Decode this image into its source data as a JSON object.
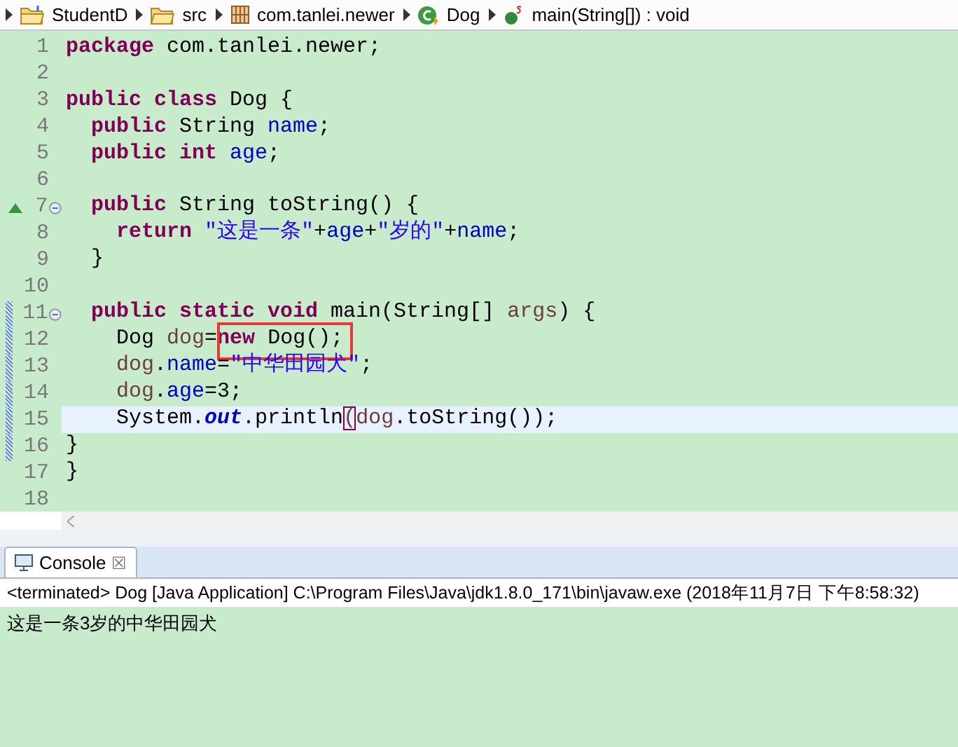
{
  "breadcrumb": [
    {
      "kind": "project",
      "label": "StudentD"
    },
    {
      "kind": "source-folder",
      "label": "src"
    },
    {
      "kind": "package",
      "label": "com.tanlei.newer"
    },
    {
      "kind": "class",
      "label": "Dog"
    },
    {
      "kind": "method",
      "label": "main(String[]) : void"
    }
  ],
  "editor": {
    "lines": [
      {
        "number": "1",
        "tokens": [
          {
            "t": "package ",
            "kind": "kw"
          },
          {
            "t": "com.tanlei.newer;",
            "kind": "plain"
          }
        ]
      },
      {
        "number": "2"
      },
      {
        "number": "3",
        "tokens": [
          {
            "t": "public class ",
            "kind": "kw"
          },
          {
            "t": "Dog {",
            "kind": "plain"
          }
        ]
      },
      {
        "number": "4",
        "tokens": [
          {
            "t": "  public ",
            "kind": "kw"
          },
          {
            "t": "String ",
            "kind": "plain"
          },
          {
            "t": "name",
            "kind": "field"
          },
          {
            "t": ";",
            "kind": "plain"
          }
        ]
      },
      {
        "number": "5",
        "tokens": [
          {
            "t": "  public int ",
            "kind": "kw"
          },
          {
            "t": "age",
            "kind": "field"
          },
          {
            "t": ";",
            "kind": "plain"
          }
        ]
      },
      {
        "number": "6"
      },
      {
        "number": "7",
        "override": true,
        "foldable": true,
        "tokens": [
          {
            "t": "  public ",
            "kind": "kw"
          },
          {
            "t": "String toString() {",
            "kind": "plain"
          }
        ]
      },
      {
        "number": "8",
        "tokens": [
          {
            "t": "    return ",
            "kind": "kw"
          },
          {
            "t": "\"这是一条\"",
            "kind": "string"
          },
          {
            "t": "+",
            "kind": "plain"
          },
          {
            "t": "age",
            "kind": "field"
          },
          {
            "t": "+",
            "kind": "plain"
          },
          {
            "t": "\"岁的\"",
            "kind": "string"
          },
          {
            "t": "+",
            "kind": "plain"
          },
          {
            "t": "name",
            "kind": "field"
          },
          {
            "t": ";",
            "kind": "plain"
          }
        ]
      },
      {
        "number": "9",
        "tokens": [
          {
            "t": "  }",
            "kind": "plain"
          }
        ]
      },
      {
        "number": "10"
      },
      {
        "number": "11",
        "foldable": true,
        "marked": true,
        "tokens": [
          {
            "t": "  public static void ",
            "kind": "kw"
          },
          {
            "t": "main(String[] ",
            "kind": "plain"
          },
          {
            "t": "args",
            "kind": "var"
          },
          {
            "t": ") {",
            "kind": "plain"
          }
        ]
      },
      {
        "number": "12",
        "marked": true,
        "boxed": true,
        "tokens": [
          {
            "t": "    Dog ",
            "kind": "plain"
          },
          {
            "t": "dog",
            "kind": "var"
          },
          {
            "t": "=",
            "kind": "plain"
          },
          {
            "t": "new ",
            "kind": "kw"
          },
          {
            "t": "Dog();",
            "kind": "plain"
          }
        ]
      },
      {
        "number": "13",
        "marked": true,
        "tokens": [
          {
            "t": "    dog",
            "kind": "var"
          },
          {
            "t": ".",
            "kind": "plain"
          },
          {
            "t": "name",
            "kind": "field"
          },
          {
            "t": "=",
            "kind": "plain"
          },
          {
            "t": "\"中华田园犬\"",
            "kind": "string"
          },
          {
            "t": ";",
            "kind": "plain"
          }
        ]
      },
      {
        "number": "14",
        "marked": true,
        "tokens": [
          {
            "t": "    dog",
            "kind": "var"
          },
          {
            "t": ".",
            "kind": "plain"
          },
          {
            "t": "age",
            "kind": "field"
          },
          {
            "t": "=3;",
            "kind": "plain"
          }
        ]
      },
      {
        "number": "15",
        "marked": true,
        "current": true,
        "tokens": [
          {
            "t": "    System.",
            "kind": "plain"
          },
          {
            "t": "out",
            "kind": "static"
          },
          {
            "t": ".println",
            "kind": "plain"
          },
          {
            "t": "(",
            "kind": "bracket"
          },
          {
            "t": "dog",
            "kind": "var"
          },
          {
            "t": ".toString());",
            "kind": "plain"
          }
        ]
      },
      {
        "number": "16",
        "marked": true,
        "tokens": [
          {
            "t": "}",
            "kind": "plain"
          }
        ]
      },
      {
        "number": "17",
        "tokens": [
          {
            "t": "}",
            "kind": "plain"
          }
        ]
      },
      {
        "number": "18"
      }
    ]
  },
  "console": {
    "tab": {
      "label": "Console",
      "close": "☒",
      "selected": true
    },
    "status": "<terminated> Dog [Java Application] C:\\Program Files\\Java\\jdk1.8.0_171\\bin\\javaw.exe (2018年11月7日 下午8:58:32)",
    "output": [
      "这是一条3岁的中华田园犬"
    ]
  }
}
